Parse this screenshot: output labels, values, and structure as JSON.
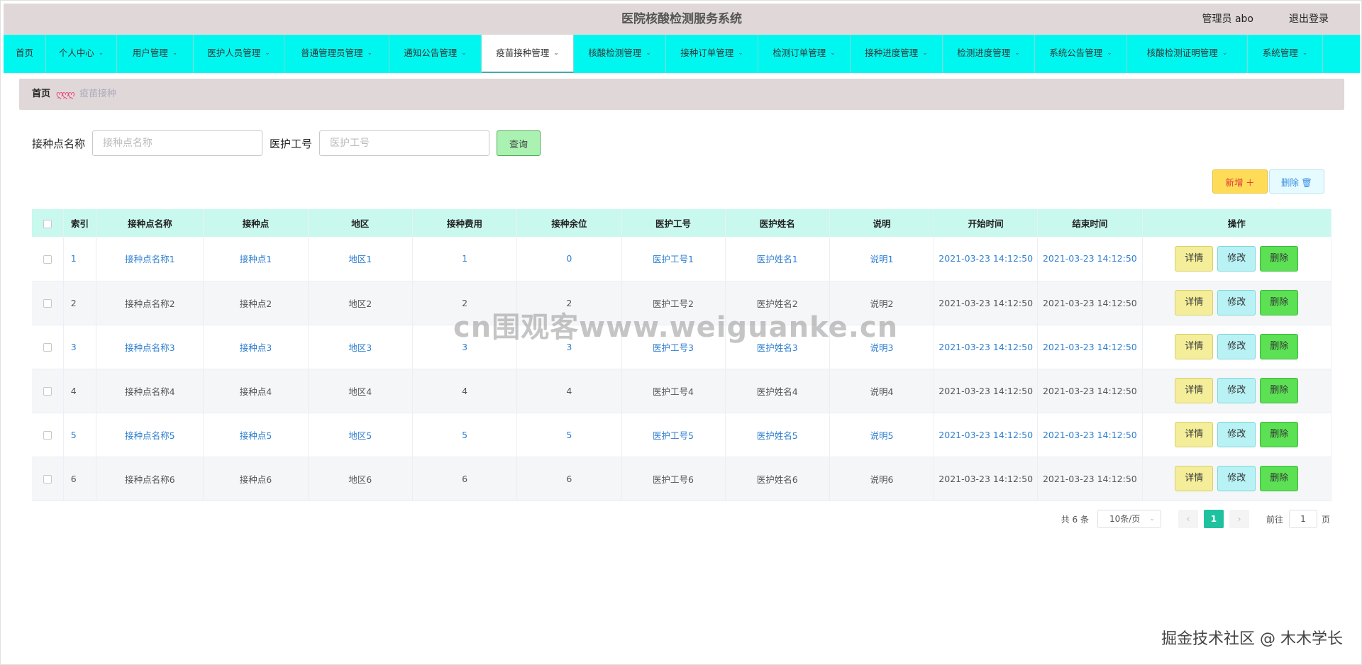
{
  "header": {
    "title": "医院核酸检测服务系统",
    "user": "管理员 abo",
    "logout": "退出登录"
  },
  "nav": {
    "items": [
      {
        "label": "首页",
        "has_dropdown": false,
        "active": false
      },
      {
        "label": "个人中心",
        "has_dropdown": true,
        "active": false
      },
      {
        "label": "用户管理",
        "has_dropdown": true,
        "active": false
      },
      {
        "label": "医护人员管理",
        "has_dropdown": true,
        "active": false
      },
      {
        "label": "普通管理员管理",
        "has_dropdown": true,
        "active": false
      },
      {
        "label": "通知公告管理",
        "has_dropdown": true,
        "active": false
      },
      {
        "label": "疫苗接种管理",
        "has_dropdown": true,
        "active": true
      },
      {
        "label": "核酸检测管理",
        "has_dropdown": true,
        "active": false
      },
      {
        "label": "接种订单管理",
        "has_dropdown": true,
        "active": false
      },
      {
        "label": "检测订单管理",
        "has_dropdown": true,
        "active": false
      },
      {
        "label": "接种进度管理",
        "has_dropdown": true,
        "active": false
      },
      {
        "label": "检测进度管理",
        "has_dropdown": true,
        "active": false
      },
      {
        "label": "系统公告管理",
        "has_dropdown": true,
        "active": false
      },
      {
        "label": "核酸检测证明管理",
        "has_dropdown": true,
        "active": false
      },
      {
        "label": "系统管理",
        "has_dropdown": true,
        "active": false
      }
    ]
  },
  "breadcrumb": {
    "home": "首页",
    "separator": "ღღღ",
    "current": "疫苗接种"
  },
  "search": {
    "field1_label": "接种点名称",
    "field1_placeholder": "接种点名称",
    "field1_value": "",
    "field2_label": "医护工号",
    "field2_placeholder": "医护工号",
    "field2_value": "",
    "query_label": "查询"
  },
  "toolbar": {
    "add_label": "新增 ＋",
    "delete_label": "删除 🗑"
  },
  "table": {
    "columns": [
      "",
      "索引",
      "接种点名称",
      "接种点",
      "地区",
      "接种费用",
      "接种余位",
      "医护工号",
      "医护姓名",
      "说明",
      "开始时间",
      "结束时间",
      "操作"
    ],
    "rows": [
      {
        "index": "1",
        "site_name": "接种点名称1",
        "site": "接种点1",
        "region": "地区1",
        "fee": "1",
        "remaining": "0",
        "staff_no": "医护工号1",
        "staff_name": "医护姓名1",
        "note": "说明1",
        "start": "2021-03-23 14:12:50",
        "end": "2021-03-23 14:12:50"
      },
      {
        "index": "2",
        "site_name": "接种点名称2",
        "site": "接种点2",
        "region": "地区2",
        "fee": "2",
        "remaining": "2",
        "staff_no": "医护工号2",
        "staff_name": "医护姓名2",
        "note": "说明2",
        "start": "2021-03-23 14:12:50",
        "end": "2021-03-23 14:12:50"
      },
      {
        "index": "3",
        "site_name": "接种点名称3",
        "site": "接种点3",
        "region": "地区3",
        "fee": "3",
        "remaining": "3",
        "staff_no": "医护工号3",
        "staff_name": "医护姓名3",
        "note": "说明3",
        "start": "2021-03-23 14:12:50",
        "end": "2021-03-23 14:12:50"
      },
      {
        "index": "4",
        "site_name": "接种点名称4",
        "site": "接种点4",
        "region": "地区4",
        "fee": "4",
        "remaining": "4",
        "staff_no": "医护工号4",
        "staff_name": "医护姓名4",
        "note": "说明4",
        "start": "2021-03-23 14:12:50",
        "end": "2021-03-23 14:12:50"
      },
      {
        "index": "5",
        "site_name": "接种点名称5",
        "site": "接种点5",
        "region": "地区5",
        "fee": "5",
        "remaining": "5",
        "staff_no": "医护工号5",
        "staff_name": "医护姓名5",
        "note": "说明5",
        "start": "2021-03-23 14:12:50",
        "end": "2021-03-23 14:12:50"
      },
      {
        "index": "6",
        "site_name": "接种点名称6",
        "site": "接种点6",
        "region": "地区6",
        "fee": "6",
        "remaining": "6",
        "staff_no": "医护工号6",
        "staff_name": "医护姓名6",
        "note": "说明6",
        "start": "2021-03-23 14:12:50",
        "end": "2021-03-23 14:12:50"
      }
    ],
    "actions": {
      "detail": "详情",
      "edit": "修改",
      "remove": "删除"
    }
  },
  "pagination": {
    "total": "共 6 条",
    "page_size": "10条/页",
    "prev": "‹",
    "current_page": "1",
    "next": "›",
    "goto_label": "前往",
    "goto_value": "1",
    "page_unit": "页"
  },
  "watermarks": {
    "center": "cn围观客www.weiguanke.cn",
    "corner": "掘金技术社区 @ 木木学长"
  },
  "colors": {
    "nav_bg": "#00f7f0",
    "header_bg": "#e0d8d8",
    "table_header_bg": "#c9f8ee",
    "link_blue": "#2f7fd1",
    "pager_active": "#1fc29e"
  }
}
